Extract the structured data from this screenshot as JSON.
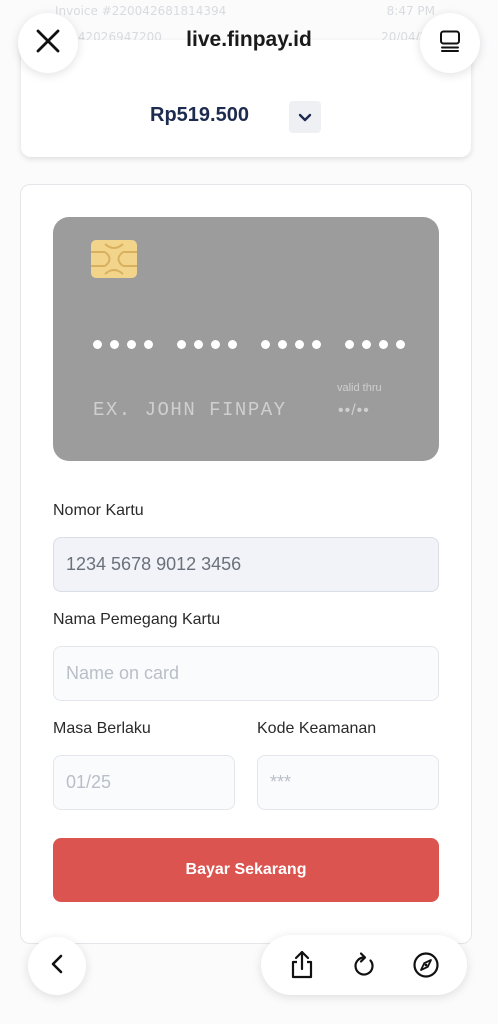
{
  "browser": {
    "url": "live.finpay.id",
    "icons": {
      "close": "close-icon",
      "reader": "reader-mode-icon",
      "back": "chevron-left-icon",
      "share": "share-icon",
      "reload": "reload-icon",
      "compass": "compass-icon"
    }
  },
  "background": {
    "invoice_line": "Invoice #220042681814394",
    "time_line": "8:47 PM",
    "ref_line": "20042026947200",
    "date_line": "20/04/20"
  },
  "summary": {
    "amount": "Rp519.500"
  },
  "card_preview": {
    "number_groups": [
      "••••",
      "••••",
      "••••",
      "••••"
    ],
    "name": "EX. JOHN FINPAY",
    "valid_thru_label": "valid thru",
    "valid_thru_value": "••/••"
  },
  "form": {
    "card_number_label": "Nomor Kartu",
    "card_number_value": "1234 5678 9012 3456",
    "holder_label": "Nama Pemegang Kartu",
    "holder_placeholder": "Name on card",
    "expiry_label": "Masa Berlaku",
    "expiry_placeholder": "01/25",
    "cvv_label": "Kode Keamanan",
    "cvv_placeholder": "***",
    "submit_label": "Bayar Sekarang"
  },
  "colors": {
    "accent": "#dc5450",
    "card_bg": "#9c9c9c",
    "chip": "#f2d48a",
    "amount_text": "#1d2b4f"
  }
}
